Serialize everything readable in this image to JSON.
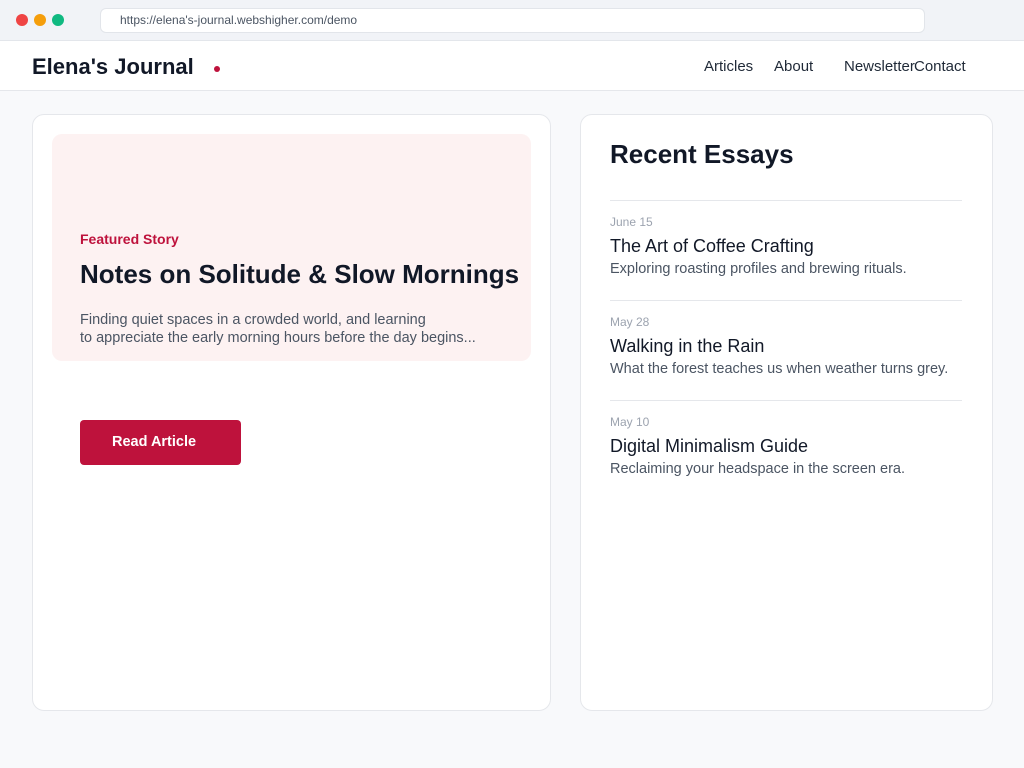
{
  "browser": {
    "url": "https://elena's-journal.webshigher.com/demo"
  },
  "header": {
    "brand": "Elena's Journal",
    "nav": [
      "Articles",
      "About",
      "Newsletter",
      "Contact"
    ]
  },
  "featured": {
    "eyebrow": "Featured Story",
    "title": "Notes on Solitude & Slow Mornings",
    "excerpt_lines": [
      "Finding quiet spaces in a crowded world, and learning",
      "to appreciate the early morning hours before the day begins..."
    ],
    "button_label": "Read Article"
  },
  "recent": {
    "title": "Recent Essays",
    "items": [
      {
        "date": "June 15",
        "title": "The Art of Coffee Crafting",
        "desc": "Exploring roasting profiles and brewing rituals."
      },
      {
        "date": "May 28",
        "title": "Walking in the Rain",
        "desc": "What the forest teaches us when weather turns grey."
      },
      {
        "date": "May 10",
        "title": "Digital Minimalism Guide",
        "desc": "Reclaiming your headspace in the screen era."
      }
    ]
  },
  "colors": {
    "accent": "#be123c",
    "hero_background": "#fdf2f2",
    "page_background": "#f8f9fb"
  }
}
